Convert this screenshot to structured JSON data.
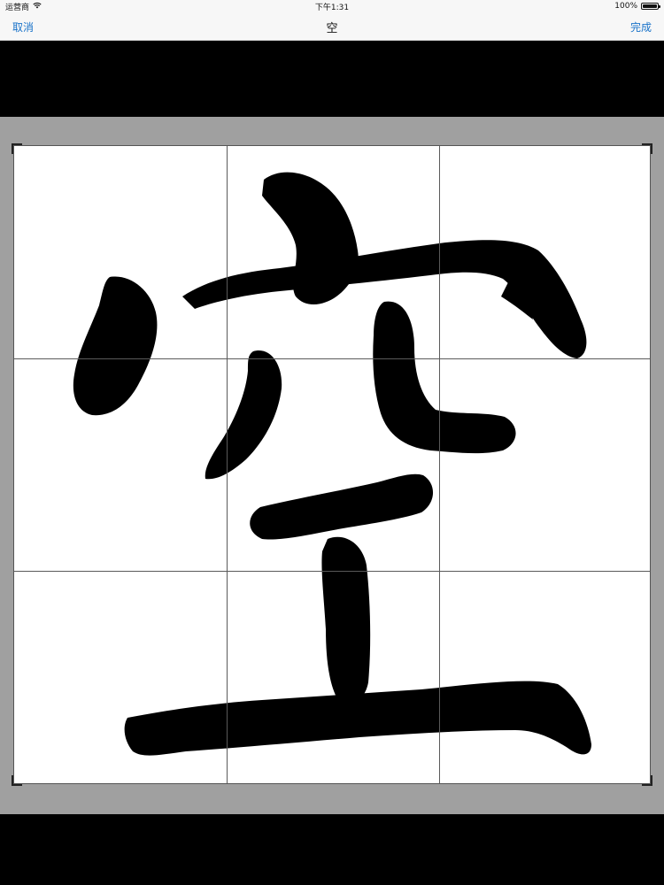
{
  "status_bar": {
    "carrier": "运营商",
    "time": "下午1:31",
    "battery_percent": "100%",
    "battery_level": 1.0,
    "wifi_icon": "wifi-icon",
    "battery_icon": "battery-icon"
  },
  "nav": {
    "cancel_label": "取消",
    "title": "空",
    "done_label": "完成",
    "accent_color": "#1a73c9"
  },
  "crop": {
    "grid": "3x3",
    "image_subject": "calligraphy-glyph"
  }
}
